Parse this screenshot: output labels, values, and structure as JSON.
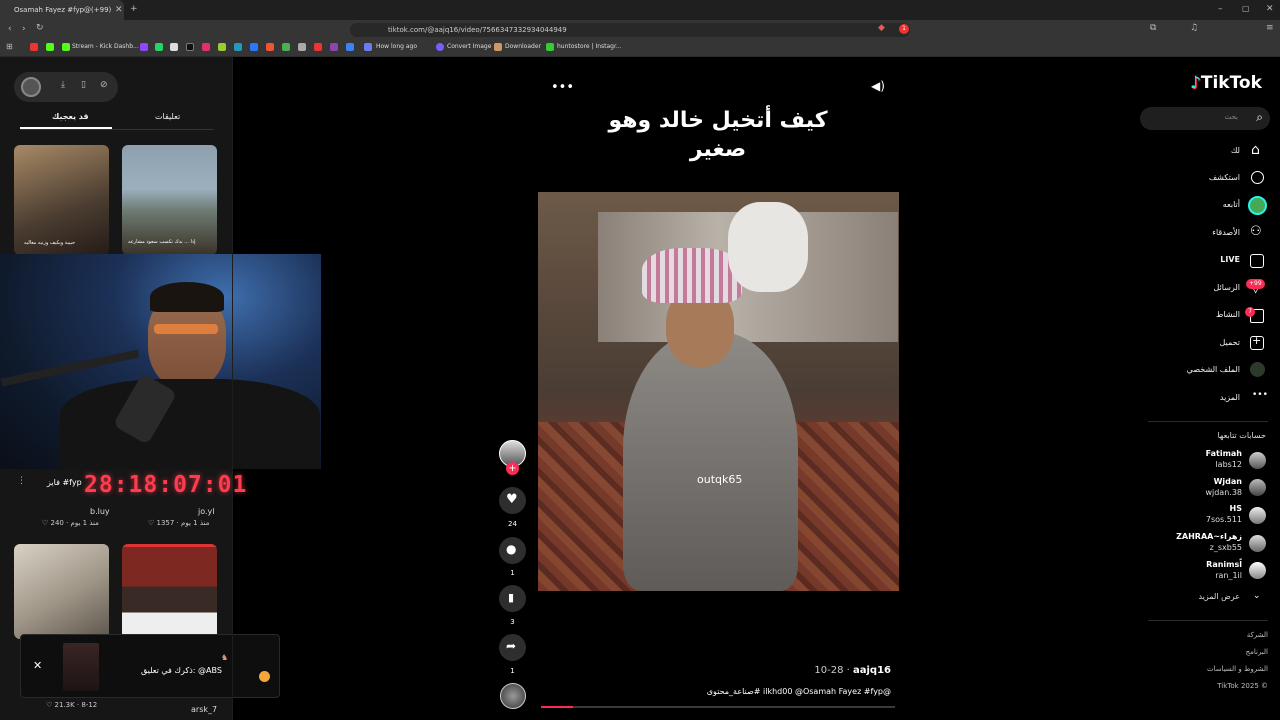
{
  "browser": {
    "tab_title": "Osamah Fayez #fyp@(+99)",
    "url": "tiktok.com/@aajq16/video/7566347332934044949",
    "bookmarks": [
      "Stream - Kick Dashb...",
      "How long ago",
      "Convert Image",
      "Downloader",
      "huntostore | Instagr..."
    ],
    "badge": "1"
  },
  "left": {
    "tab_comments": "تعليقات",
    "tab_foryou": "قد يعجبك",
    "timer": "28:18:07:01",
    "card1_user": "jo.yl",
    "card1_meta": "♡ 1357 · منذ 1 يوم",
    "card2_user": "b.luy",
    "card2_meta": "♡ 240 · منذ 1 يوم",
    "card_caption": "فايز #fyp",
    "card3_meta": "♡ 21.3K · 8-12",
    "card4_user": "arsk_7",
    "toast_text": "ذكرك في تعليق: @ABS",
    "thumb_caption1": "حبيبة ويكيف وزنيه معاليه",
    "thumb_caption2": "إذا ... بدك تكسب سعود مشارعه"
  },
  "video": {
    "caption_overlay": "كيف أتخيل خالد وهو صغير",
    "watermark": "outqk65",
    "author": "aajq16",
    "date": "10-28",
    "description": "@ilkhd00 @Osamah Fayez #fyp #صناعة_محتوى",
    "likes": "24",
    "comments": "1",
    "saves": "3",
    "shares": "1",
    "progress": 0.09
  },
  "sidebar": {
    "logo": "TikTok",
    "search_placeholder": "بحث",
    "nav": [
      "لك",
      "استكشف",
      "أتابعه",
      "الأصدقاء",
      "LIVE",
      "الرسائل",
      "النشاط",
      "تحميل",
      "الملف الشخصي",
      "المزيد"
    ],
    "msg_badge": "+99",
    "activity_badge": "7",
    "following_title": "حسابات تتابعها",
    "accounts": [
      {
        "name": "Fatimah",
        "handle": "labs12"
      },
      {
        "name": "Wjdan",
        "handle": "wjdan.38"
      },
      {
        "name": "HS",
        "handle": "7sos.511"
      },
      {
        "name": "ZAHRAA~زهراء",
        "handle": "z_sxb55"
      },
      {
        "name": "Ranimsاً",
        "handle": "ran_1il"
      }
    ],
    "see_more": "عرض المزيد",
    "footer": [
      "الشركة",
      "البرنامج",
      "الشروط و السياسات",
      "TikTok 2025 ©"
    ]
  },
  "colors": {
    "accent": "#fe2c55",
    "cyan": "#25f4ee",
    "timer": "#ff3b4d"
  }
}
